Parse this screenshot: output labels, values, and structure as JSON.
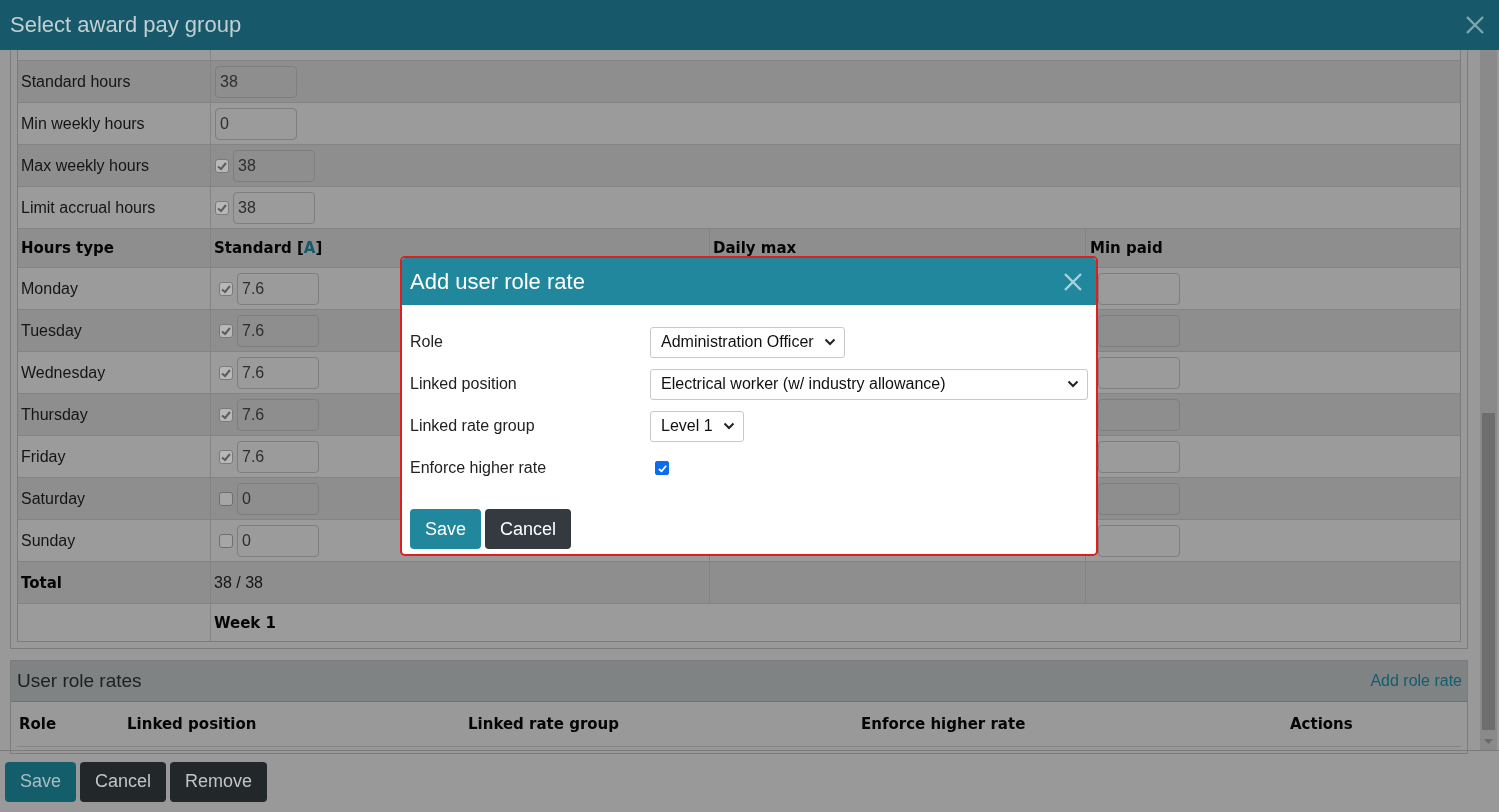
{
  "dialog": {
    "title": "Select award pay group"
  },
  "settings": [
    {
      "label": "Standard hours",
      "kind": "input",
      "value": "38"
    },
    {
      "label": "Min weekly hours",
      "kind": "input",
      "value": "0"
    },
    {
      "label": "Max weekly hours",
      "kind": "check_input",
      "checked": true,
      "value": "38"
    },
    {
      "label": "Limit accrual hours",
      "kind": "check_input",
      "checked": true,
      "value": "38"
    }
  ],
  "hours_table": {
    "first_column": "Hours type",
    "standard_header": {
      "before": "Standard [",
      "link": "A",
      "after": "]"
    },
    "other_columns": [
      "Daily max",
      "Min paid"
    ],
    "rows": [
      {
        "day": "Monday",
        "checked": true,
        "standard": "7.6"
      },
      {
        "day": "Tuesday",
        "checked": true,
        "standard": "7.6"
      },
      {
        "day": "Wednesday",
        "checked": true,
        "standard": "7.6"
      },
      {
        "day": "Thursday",
        "checked": true,
        "standard": "7.6"
      },
      {
        "day": "Friday",
        "checked": true,
        "standard": "7.6"
      },
      {
        "day": "Saturday",
        "checked": false,
        "standard": "0"
      },
      {
        "day": "Sunday",
        "checked": false,
        "standard": "0"
      }
    ],
    "total": {
      "label": "Total",
      "value": "38 / 38"
    },
    "week_label": "Week 1"
  },
  "user_role_rates": {
    "title": "User role rates",
    "add_link": "Add role rate",
    "columns": [
      "Role",
      "Linked position",
      "Linked rate group",
      "Enforce higher rate",
      "Actions"
    ]
  },
  "footer_buttons": [
    {
      "label": "Save",
      "kind": "primary"
    },
    {
      "label": "Cancel",
      "kind": "dark"
    },
    {
      "label": "Remove",
      "kind": "dark"
    }
  ],
  "modal": {
    "title": "Add user role rate",
    "fields": [
      {
        "label": "Role",
        "kind": "select",
        "value": "Administration Officer"
      },
      {
        "label": "Linked position",
        "kind": "select_wide",
        "value": "Electrical worker (w/ industry allowance)"
      },
      {
        "label": "Linked rate group",
        "kind": "select",
        "value": "Level 1"
      },
      {
        "label": "Enforce higher rate",
        "kind": "checkbox",
        "checked": true
      }
    ],
    "buttons": [
      {
        "label": "Save",
        "kind": "primary"
      },
      {
        "label": "Cancel",
        "kind": "dark"
      }
    ]
  }
}
